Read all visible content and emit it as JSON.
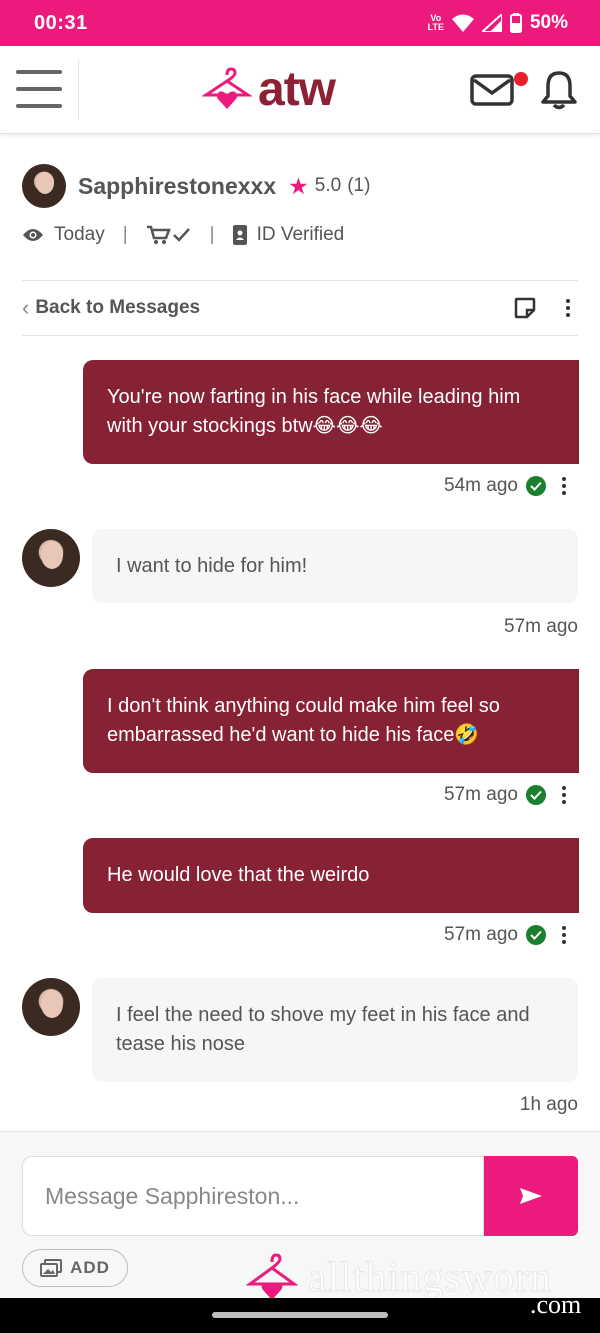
{
  "status_bar": {
    "time": "00:31",
    "network_badge": "Vo LTE",
    "battery": "50%"
  },
  "header": {
    "logo_text": "atw",
    "brand_color": "#8b2133",
    "accent_color": "#ec1a7d",
    "menu_icon": "hamburger-icon",
    "mail_icon": "mail-icon",
    "bell_icon": "bell-icon"
  },
  "profile": {
    "name": "Sapphirestonexxx",
    "rating": "5.0",
    "rating_count": "(1)",
    "last_seen": "Today",
    "id_verified": "ID Verified"
  },
  "toolbar": {
    "back_label": "Back to Messages"
  },
  "messages": [
    {
      "direction": "out",
      "text": "You're now farting in his face while leading him with your stockings btw😂😂😂",
      "time": "54m ago",
      "read": true
    },
    {
      "direction": "in",
      "text": "I want to hide for him!",
      "time": "57m ago"
    },
    {
      "direction": "out",
      "text": "I don't think anything could make him feel so embarrassed he'd want to hide his face🤣",
      "time": "57m ago",
      "read": true
    },
    {
      "direction": "out",
      "text": "He would love that the weirdo",
      "time": "57m ago",
      "read": true
    },
    {
      "direction": "in",
      "text": "I feel the need to shove my feet in his face and tease his nose",
      "time": "1h ago"
    }
  ],
  "composer": {
    "placeholder": "Message Sapphireston...",
    "add_label": "ADD"
  },
  "watermark": {
    "text": "allthingsworn",
    "suffix": ".com"
  }
}
